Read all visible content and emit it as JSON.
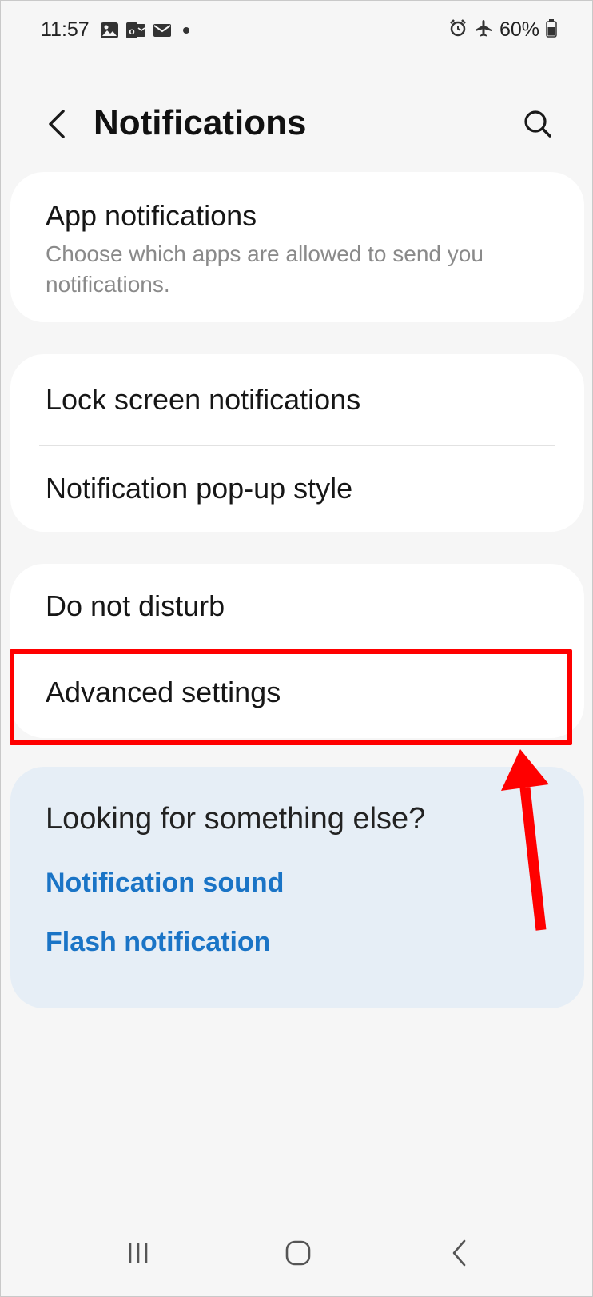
{
  "status_bar": {
    "time": "11:57",
    "left_icons": [
      "gallery-icon",
      "outlook-icon",
      "mail-icon",
      "dot-icon"
    ],
    "right_icons": [
      "alarm-icon",
      "airplane-mode-icon"
    ],
    "battery": "60%"
  },
  "header": {
    "title": "Notifications",
    "back_icon": "chevron-left-icon",
    "search_icon": "search-icon"
  },
  "groups": {
    "app_notifications": {
      "title": "App notifications",
      "subtitle": "Choose which apps are allowed to send you notifications."
    },
    "lock_screen": {
      "title": "Lock screen notifications"
    },
    "popup_style": {
      "title": "Notification pop-up style"
    },
    "dnd": {
      "title": "Do not disturb"
    },
    "advanced": {
      "title": "Advanced settings"
    }
  },
  "suggestions": {
    "heading": "Looking for something else?",
    "links": [
      "Notification sound",
      "Flash notification"
    ]
  },
  "annotation": {
    "highlight_color": "#ff0000"
  },
  "colors": {
    "background": "#f6f6f6",
    "card": "#ffffff",
    "info_card": "#e6eef6",
    "link": "#1a74c6"
  },
  "nav_bar": {
    "icons": [
      "recents-icon",
      "home-icon",
      "back-icon"
    ]
  }
}
